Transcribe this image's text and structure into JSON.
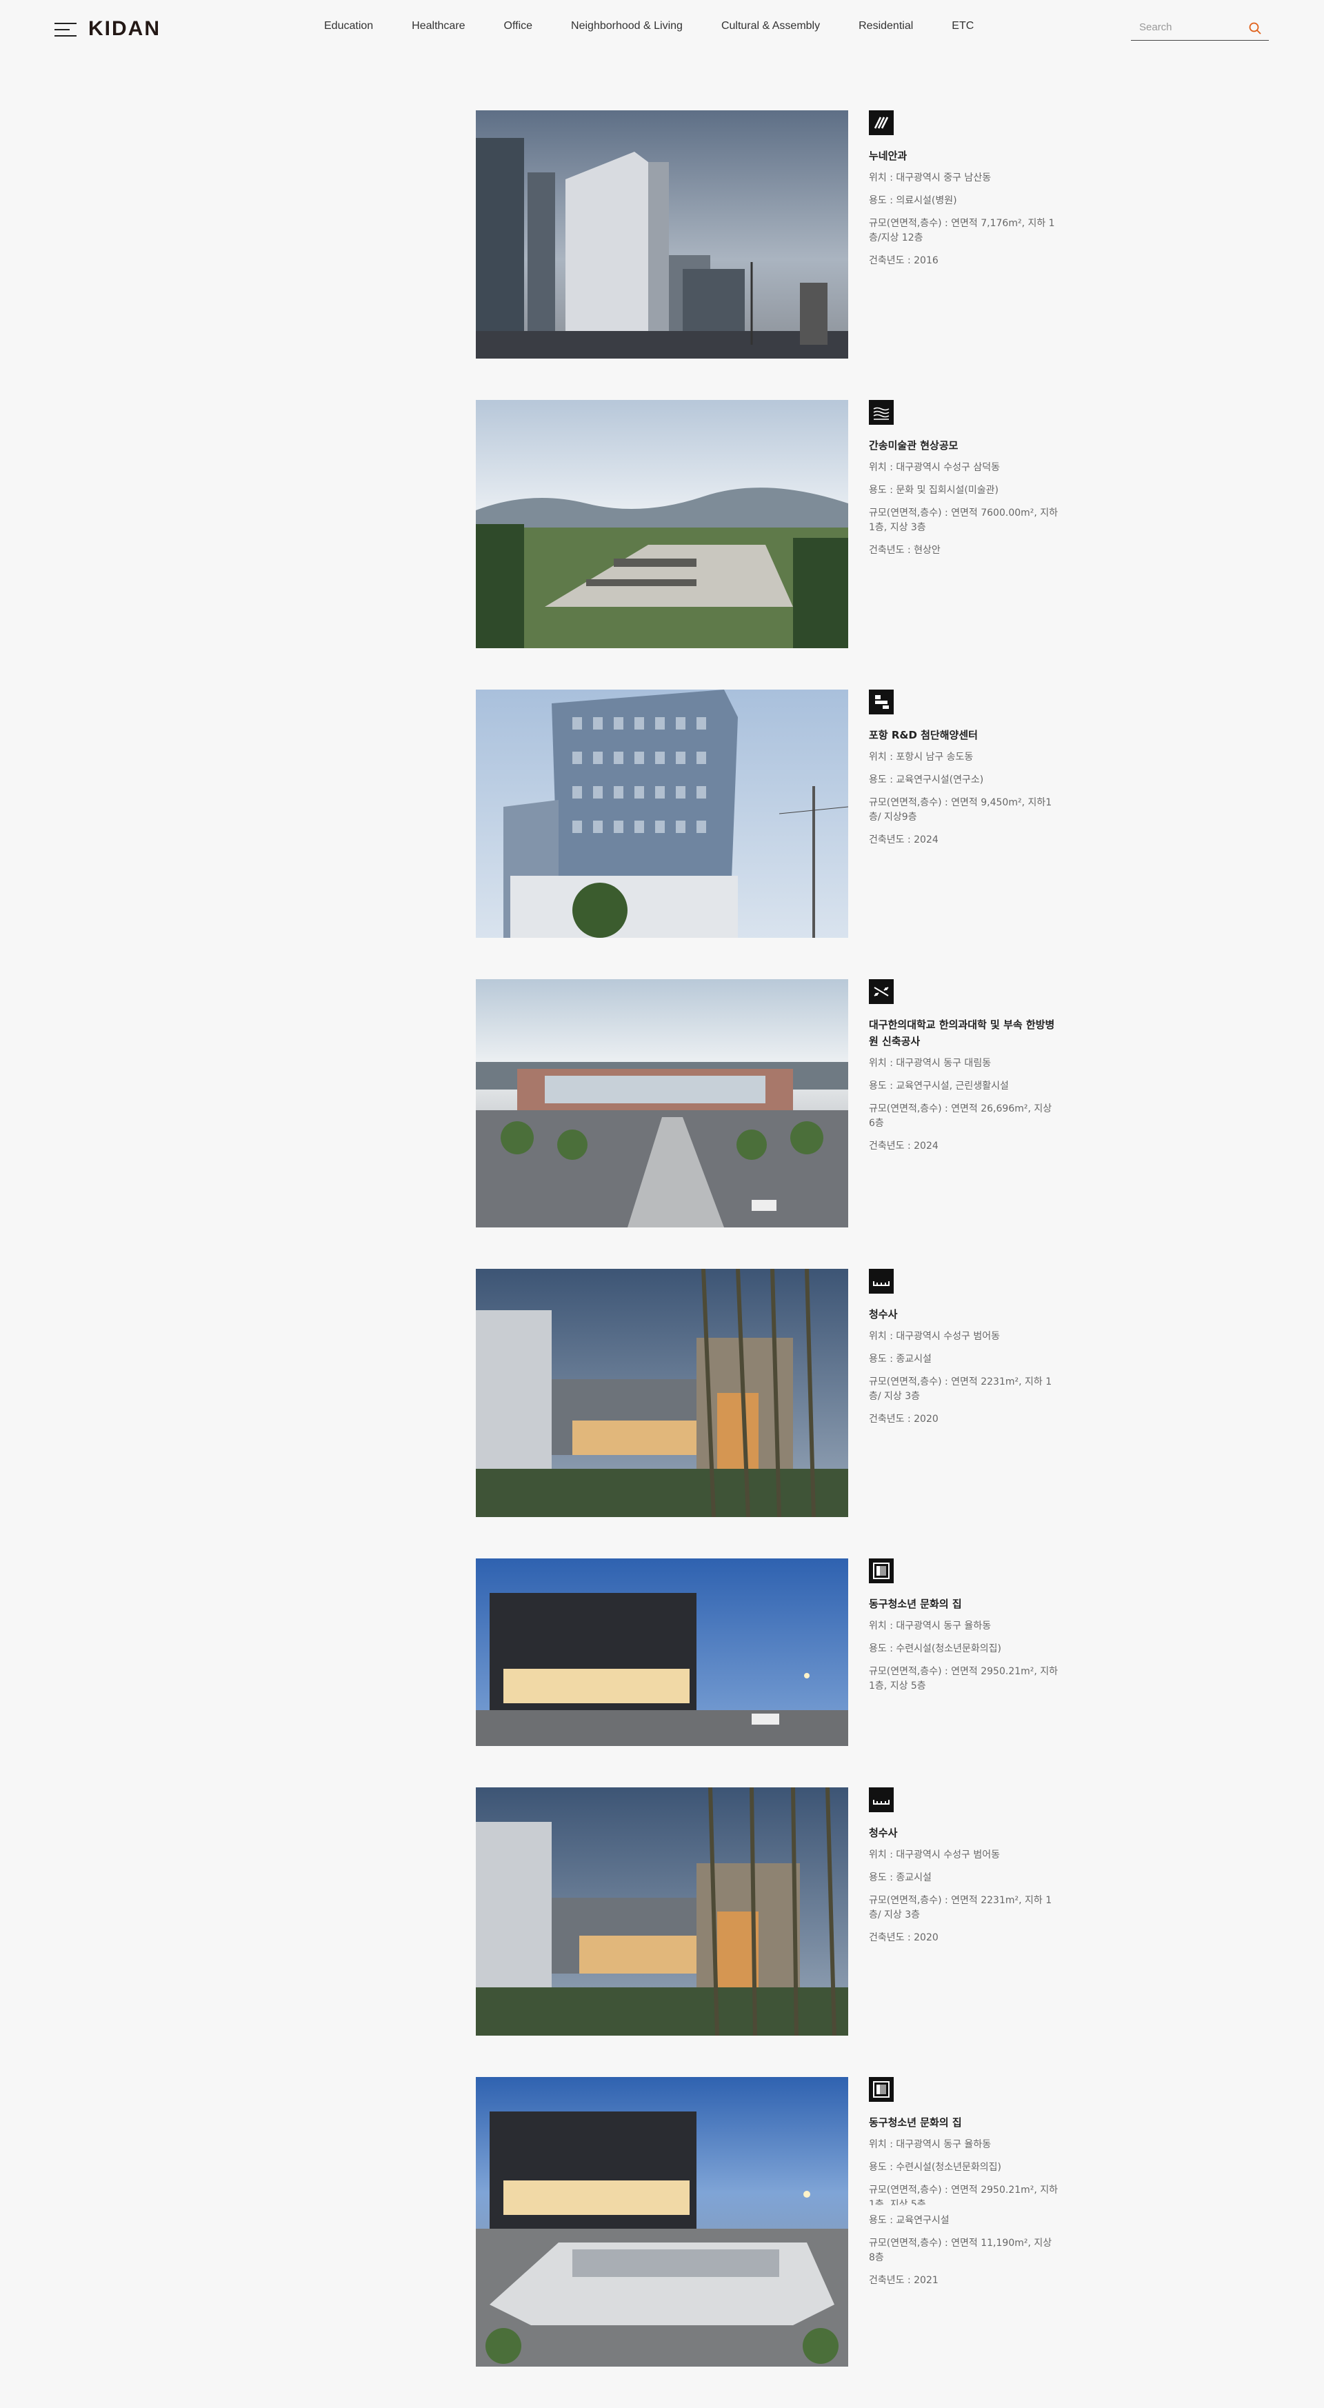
{
  "header": {
    "logo": "KIDAN",
    "nav": [
      "Education",
      "Healthcare",
      "Office",
      "Neighborhood & Living",
      "Cultural & Assembly",
      "Residential",
      "ETC"
    ],
    "search_placeholder": "Search"
  },
  "projects": [
    {
      "icon": "diagonal-lines-pictogram",
      "title": "누네안과",
      "location": "위치 : 대구광역시 중구 남산동",
      "use": "용도 : 의료시설(병원)",
      "scale": "규모(연면적,층수) : 연면적 7,176m², 지하 1층/지상 12층",
      "year": "건축년도 : 2016"
    },
    {
      "icon": "wave-lines-pictogram",
      "title": "간송미술관 현상공모",
      "location": "위치 : 대구광역시 수성구 삼덕동",
      "use": "용도 : 문화 및 집회시설(미술관)",
      "scale": "규모(연면적,층수) : 연면적 7600.00m², 지하 1층, 지상 3층",
      "year": "건축년도 : 현상안"
    },
    {
      "icon": "stacked-bars-pictogram",
      "title": "포항 R&D 첨단해양센터",
      "location": "위치 : 포항시 남구 송도동",
      "use": "용도 : 교육연구시설(연구소)",
      "scale": "규모(연면적,층수) : 연면적 9,450m², 지하1층/ 지상9층",
      "year": "건축년도 : 2024"
    },
    {
      "icon": "crossed-lines-pictogram",
      "title": "대구한의대학교 한의과대학 및 부속 한방병원 신축공사",
      "location": "위치 : 대구광역시 동구 대림동",
      "use": "용도 : 교육연구시설, 근린생활시설",
      "scale": "규모(연면적,층수) : 연면적 26,696m², 지상 6층",
      "year": "건축년도 : 2024"
    },
    {
      "icon": "roofline-pictogram",
      "title": "청수사",
      "location": "위치 : 대구광역시 수성구 범어동",
      "use": "용도 : 종교시설",
      "scale": "규모(연면적,층수) : 연면적 2231m², 지하 1층/ 지상 3층",
      "year": "건축년도 : 2020"
    },
    {
      "icon": "framed-square-pictogram",
      "title": "동구청소년 문화의 집",
      "location": "위치 : 대구광역시 동구 율하동",
      "use": "용도 : 수련시설(청소년문화의집)",
      "scale": "규모(연면적,층수) : 연면적 2950.21m², 지하 1층, 지상 5층",
      "year": ""
    },
    {
      "icon": "roofline-pictogram",
      "title": "청수사",
      "location": "위치 : 대구광역시 수성구 범어동",
      "use": "용도 : 종교시설",
      "scale": "규모(연면적,층수) : 연면적 2231m², 지하 1층/ 지상 3층",
      "year": "건축년도 : 2020"
    },
    {
      "icon": "framed-square-pictogram",
      "title": "동구청소년 문화의 집",
      "location": "위치 : 대구광역시 동구 율하동",
      "use": "용도 : 수련시설(청소년문화의집)",
      "scale": "규모(연면적,층수) : 연면적 2950.21m², 지하 1층, 지상 5층",
      "use2": "용도 : 교육연구시설",
      "scale2": "규모(연면적,층수) : 연면적 11,190m², 지상 8층",
      "year": "건축년도 : 2021"
    }
  ],
  "colors": {
    "background": "#f7f7f7",
    "accent": "#e0621c",
    "text": "#333333"
  }
}
